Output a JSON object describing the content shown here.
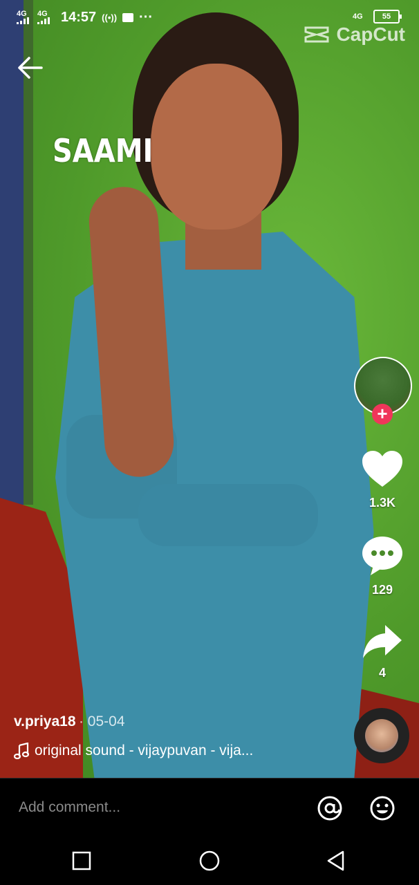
{
  "status_bar": {
    "network1": "4G",
    "network2": "4G",
    "time": "14:57",
    "more": "···",
    "network3": "4G",
    "battery": "55"
  },
  "watermark": {
    "brand": "CapCut"
  },
  "video": {
    "overlay_text": "SAAMI"
  },
  "post": {
    "username": "v.priya18",
    "date": "· 05-04",
    "sound": "original sound - vijaypuvan - vija..."
  },
  "rail": {
    "likes": "1.3K",
    "comments": "129",
    "shares": "4",
    "follow_label": "+"
  },
  "comment_bar": {
    "placeholder": "Add comment..."
  },
  "icons": {
    "back": "arrow-left-icon",
    "like": "heart-icon",
    "comment": "chat-bubble-icon",
    "share": "share-arrow-icon",
    "mention": "at-icon",
    "emoji": "emoji-icon",
    "music": "music-note-icon"
  },
  "colors": {
    "follow": "#f0365a",
    "background": "#000000"
  }
}
